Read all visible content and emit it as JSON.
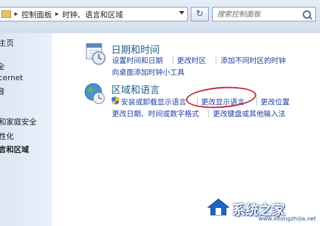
{
  "address": {
    "crumbs": [
      "控制面板",
      "时钟、语言和区域"
    ],
    "separator": "▸"
  },
  "search": {
    "placeholder": "搜索控制面板"
  },
  "sidebar": {
    "items": [
      {
        "label": "主页"
      },
      {
        "label": "全"
      },
      {
        "label": "cernet"
      },
      {
        "label": "音"
      },
      {
        "label": "和家庭安全"
      },
      {
        "label": "性化"
      },
      {
        "label": "言和区域"
      }
    ]
  },
  "sections": {
    "datetime": {
      "title": "日期和时间",
      "links": [
        "设置时间和日期",
        "更改时区",
        "添加不同时区的时钟",
        "向桌面添加时钟小工具"
      ]
    },
    "region": {
      "title": "区域和语言",
      "links": [
        "安装或卸载显示语言",
        "更改显示语言",
        "更改位置",
        "更改日期、时间或数字格式",
        "更改键盘或其他输入法"
      ]
    }
  },
  "watermark": {
    "text": "系统之家",
    "url": "www.xitongzhijia.net"
  },
  "colors": {
    "link": "#1e3f9c",
    "title": "#1e5c8a",
    "highlight_circle": "#c0263b"
  }
}
